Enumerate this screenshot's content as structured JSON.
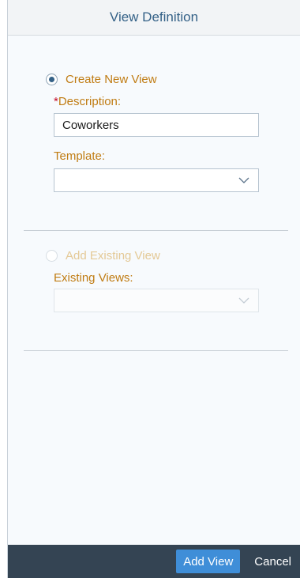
{
  "dialog": {
    "title": "View Definition"
  },
  "create_new": {
    "radio_label": "Create New View",
    "selected": true,
    "description_required_marker": "*",
    "description_label": "Description:",
    "description_value": "Coworkers",
    "template_label": "Template:",
    "template_value": ""
  },
  "add_existing": {
    "radio_label": "Add Existing View",
    "selected": false,
    "enabled": false,
    "existing_views_label": "Existing Views:",
    "existing_views_value": ""
  },
  "footer": {
    "add_view_label": "Add View",
    "cancel_label": "Cancel"
  },
  "icons": {
    "template_dropdown": "chevron-down-icon",
    "existing_dropdown": "chevron-down-icon"
  },
  "colors": {
    "accent": "#346187",
    "label": "#c07c13",
    "required": "#c50e2a",
    "footer_bg": "#344453",
    "primary_button": "#3f8ed8"
  }
}
